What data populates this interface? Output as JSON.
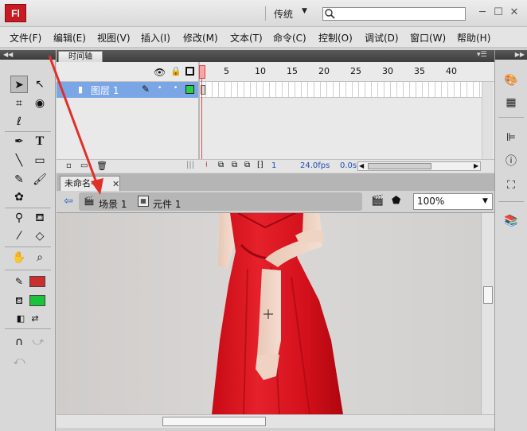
{
  "app": {
    "logo": "Fl",
    "workspace": "传统"
  },
  "window_buttons": {
    "minimize": "─",
    "restore": "☐",
    "close": "✕"
  },
  "menu": [
    "文件(F)",
    "编辑(E)",
    "视图(V)",
    "插入(I)",
    "修改(M)",
    "文本(T)",
    "命令(C)",
    "控制(O)",
    "调试(D)",
    "窗口(W)",
    "帮助(H)"
  ],
  "timeline": {
    "tab_label": "时间轴",
    "frame_numbers": [
      "1",
      "5",
      "10",
      "15",
      "20",
      "25",
      "30",
      "35",
      "40"
    ],
    "layer_name": "图层 1",
    "current_frame": "1",
    "fps": "24.0fps",
    "time": "0.0s"
  },
  "document": {
    "tab_label": "未命名-1",
    "close": "✕"
  },
  "editbar": {
    "scene": "场景 1",
    "symbol": "元件 1",
    "zoom": "100%"
  },
  "colors": {
    "stroke": "#c9302c",
    "fill": "#19c33a",
    "layer_highlight": "#7aa6e6",
    "playhead": "#e24b4b"
  },
  "icons": {
    "tools": [
      "selection-arrow-icon",
      "subselection-icon",
      "free-transform-icon",
      "3d-rotation-icon",
      "lasso-icon",
      "pen-icon",
      "text-icon",
      "line-icon",
      "rectangle-icon",
      "pencil-icon",
      "brush-icon",
      "deco-icon",
      "bone-icon",
      "paint-bucket-icon",
      "eyedropper-icon",
      "eraser-icon",
      "hand-icon",
      "zoom-icon"
    ],
    "right": [
      "color-icon",
      "swatches-icon",
      "align-icon",
      "info-icon",
      "transform-icon",
      "library-icon"
    ]
  }
}
